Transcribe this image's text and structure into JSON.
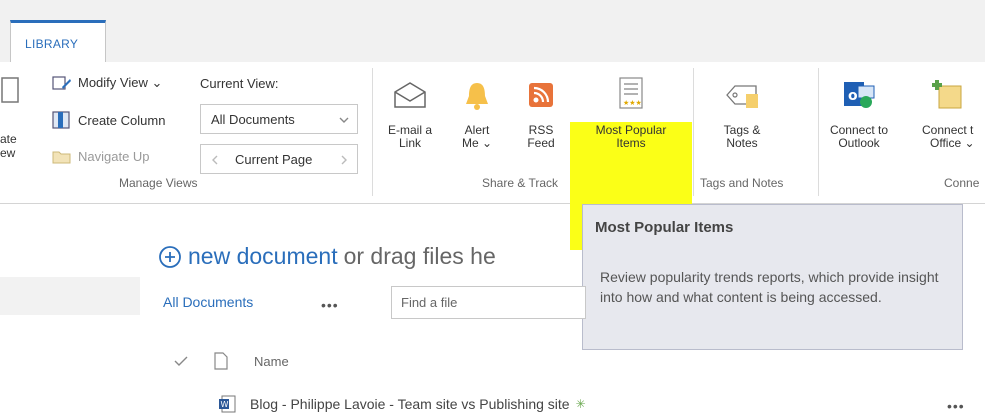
{
  "ribbon": {
    "tab_label": "LIBRARY",
    "manage_views": {
      "partial_label_1": "ate",
      "partial_label_2": "ew",
      "modify_view": "Modify View ⌄",
      "create_column": "Create Column",
      "navigate_up": "Navigate Up",
      "current_view_label": "Current View:",
      "current_view_value": "All Documents",
      "current_page": "Current Page",
      "group_label": "Manage Views"
    },
    "share_track": {
      "email_link_line1": "E-mail a",
      "email_link_line2": "Link",
      "alert_me_line1": "Alert",
      "alert_me_line2": "Me ⌄",
      "rss_line1": "RSS",
      "rss_line2": "Feed",
      "most_popular_line1": "Most Popular",
      "most_popular_line2": "Items",
      "group_label": "Share & Track"
    },
    "tags_notes": {
      "tags_line1": "Tags &",
      "tags_line2": "Notes",
      "group_label": "Tags and Notes"
    },
    "connect": {
      "outlook_line1": "Connect to",
      "outlook_line2": "Outlook",
      "office_line1": "Connect t",
      "office_line2": "Office ⌄",
      "group_label": "Conne"
    }
  },
  "tooltip": {
    "title": "Most Popular Items",
    "body": "Review popularity trends reports, which provide insight into how and what content is being accessed."
  },
  "main": {
    "new_document": "new document",
    "new_document_rest": "or drag files he",
    "view_name": "All Documents",
    "view_ellipsis": "•••",
    "search_placeholder": "Find a file",
    "column_name": "Name",
    "rows": [
      {
        "name": "Blog - Philippe Lavoie - Team site vs Publishing site",
        "new_marker": "✳",
        "menu": "•••"
      }
    ]
  },
  "colors": {
    "accent": "#2a6ebb",
    "highlight": "#fbff17",
    "tooltip_bg": "#e7e8ee"
  }
}
